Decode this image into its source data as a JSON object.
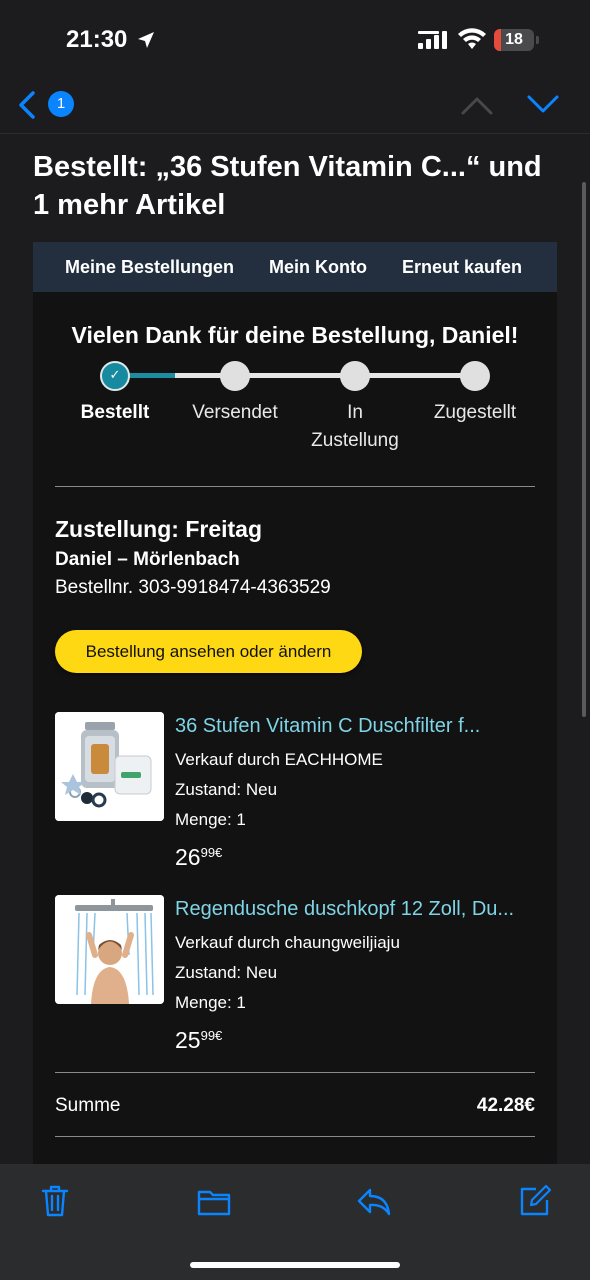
{
  "status_bar": {
    "time": "21:30",
    "battery_level": "18",
    "battery_fraction": 0.18
  },
  "nav": {
    "unread_count": "1"
  },
  "email": {
    "subject": "Bestellt: „36 Stufen Vitamin C...“ und 1 mehr Artikel",
    "links": [
      "Meine Bestellungen",
      "Mein Konto",
      "Erneut kaufen"
    ],
    "thanks": "Vielen Dank für deine Bestellung, Daniel!",
    "progress": {
      "steps": [
        "Bestellt",
        "Versendet",
        "In Zustellung",
        "Zugestellt"
      ],
      "current_step": 0
    },
    "delivery": {
      "title": "Zustellung: Freitag",
      "recipient": "Daniel – Mörlenbach",
      "order_number": "Bestellnr. 303-9918474-4363529"
    },
    "cta_label": "Bestellung ansehen oder ändern",
    "items": [
      {
        "title": "36 Stufen Vitamin C Duschfilter f...",
        "seller": "Verkauf durch EACHHOME",
        "condition": "Zustand: Neu",
        "quantity": "Menge: 1",
        "price_whole": "26",
        "price_fraction": "99€"
      },
      {
        "title": "Regendusche duschkopf 12 Zoll, Du...",
        "seller": "Verkauf durch chaungweiljiaju",
        "condition": "Zustand: Neu",
        "quantity": "Menge: 1",
        "price_whole": "25",
        "price_fraction": "99€"
      }
    ],
    "total": {
      "label": "Summe",
      "value": "42.28€"
    }
  },
  "colors": {
    "background": "#1c1c1e",
    "accent_blue": "#0a84ff",
    "link_bar": "#232f3e",
    "cta_yellow": "#ffd814",
    "item_link": "#7fd4e6",
    "progress_teal": "#178aa0"
  },
  "icons": {
    "status": [
      "location-arrow-icon",
      "signal-icon",
      "wifi-icon",
      "battery-icon"
    ],
    "nav": [
      "back-chevron-icon",
      "up-chevron-icon",
      "down-chevron-icon"
    ],
    "toolbar": [
      "trash-icon",
      "folder-icon",
      "reply-icon",
      "compose-icon"
    ]
  }
}
